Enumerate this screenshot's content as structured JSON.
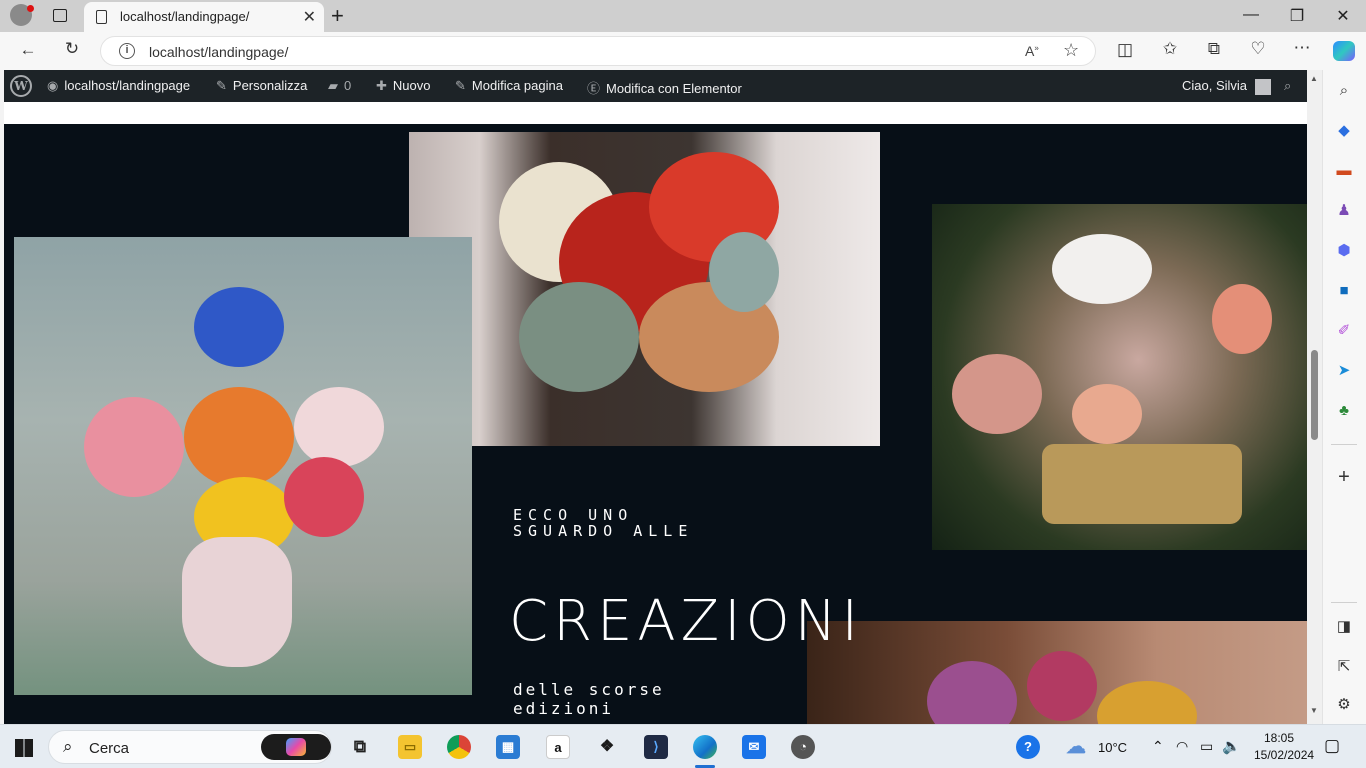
{
  "browser": {
    "tab_title": "localhost/landingpage/",
    "url": "localhost/landingpage/",
    "new_tab_symbol": "+",
    "window_controls": [
      "—",
      "❐",
      "✕"
    ]
  },
  "wp_admin_bar": {
    "site_name": "localhost/landingpage",
    "customize": "Personalizza",
    "comments_count": "0",
    "new": "Nuovo",
    "edit_page": "Modifica pagina",
    "edit_elementor": "Modifica con Elementor",
    "greeting": "Ciao, Silvia"
  },
  "hero": {
    "kicker_line1": "ECCO UNO",
    "kicker_line2": "SGUARDO ALLE",
    "headline": "CREAZIONI",
    "sub_line1": "delle scorse",
    "sub_line2": "edizioni"
  },
  "taskbar": {
    "search_label": "Cerca",
    "temperature": "10°C",
    "time": "18:05",
    "date": "15/02/2024"
  },
  "colors": {
    "hero_bg": "#070f17",
    "wp_bar_bg": "#1d2327",
    "taskbar_bg": "#e6ecf2"
  }
}
